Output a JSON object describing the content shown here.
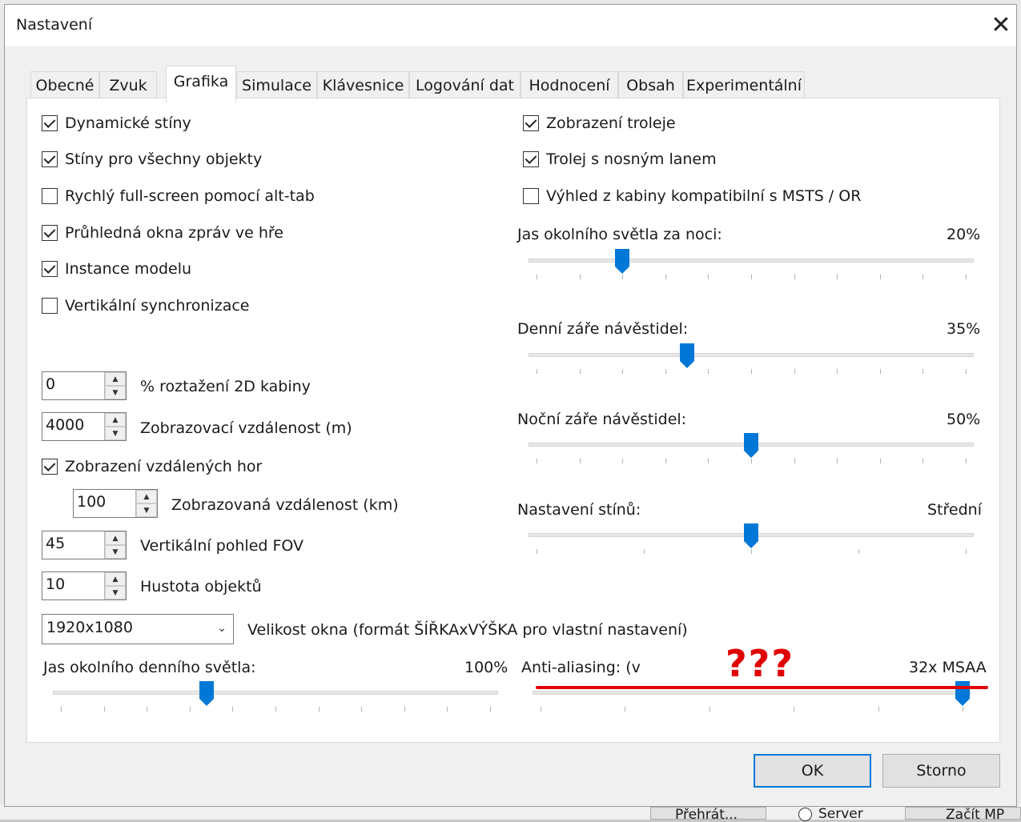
{
  "window": {
    "title": "Nastavení",
    "close_glyph": "✕"
  },
  "tabs": [
    {
      "label": "Obecné",
      "active": false
    },
    {
      "label": "Zvuk",
      "active": false
    },
    {
      "label": "Grafika",
      "active": true
    },
    {
      "label": "Simulace",
      "active": false
    },
    {
      "label": "Klávesnice",
      "active": false
    },
    {
      "label": "Logování dat",
      "active": false
    },
    {
      "label": "Hodnocení",
      "active": false
    },
    {
      "label": "Obsah",
      "active": false
    },
    {
      "label": "Experimentální",
      "active": false
    }
  ],
  "left_checkboxes": [
    {
      "label": "Dynamické stíny",
      "checked": true
    },
    {
      "label": "Stíny pro všechny objekty",
      "checked": true
    },
    {
      "label": "Rychlý full-screen pomocí alt-tab",
      "checked": false
    },
    {
      "label": "Průhledná okna zpráv ve hře",
      "checked": true
    },
    {
      "label": "Instance modelu",
      "checked": true
    },
    {
      "label": "Vertikální synchronizace",
      "checked": false
    }
  ],
  "right_checkboxes": [
    {
      "label": "Zobrazení troleje",
      "checked": true
    },
    {
      "label": "Trolej s nosným lanem",
      "checked": true
    },
    {
      "label": "Výhled z kabiny kompatibilní s MSTS / OR",
      "checked": false
    }
  ],
  "spinners": {
    "cab_stretch": {
      "value": "0",
      "label": "% roztažení 2D kabiny"
    },
    "view_distance": {
      "value": "4000",
      "label": "Zobrazovací vzdálenost (m)"
    },
    "mountain_distance": {
      "value": "100",
      "label": "Zobrazovaná vzdálenost (km)"
    },
    "fov": {
      "value": "45",
      "label": "Vertikální pohled FOV"
    },
    "object_density": {
      "value": "10",
      "label": "Hustota objektů"
    }
  },
  "distant_mountains": {
    "label": "Zobrazení vzdálených hor",
    "checked": true
  },
  "window_size": {
    "value": "1920x1080",
    "label": "Velikost okna (formát ŠÍŘKAxVÝŠKA pro vlastní nastavení)"
  },
  "sliders": {
    "night_ambient": {
      "label": "Jas okolního světla za noci:",
      "value_text": "20%",
      "fraction": 0.2
    },
    "day_signal_glow": {
      "label": "Denní záře návěstidel:",
      "value_text": "35%",
      "fraction": 0.35
    },
    "night_signal_glow": {
      "label": "Noční záře návěstidel:",
      "value_text": "50%",
      "fraction": 0.5
    },
    "shadow_quality": {
      "label": "Nastavení stínů:",
      "value_text": "Střední",
      "fraction": 0.5
    },
    "day_ambient": {
      "label": "Jas okolního denního světla:",
      "value_text": "100%",
      "fraction": 0.34
    },
    "anti_aliasing": {
      "label": "Anti-aliasing: (v",
      "value_text": "32x MSAA",
      "fraction": 1.0
    }
  },
  "annotation": {
    "text": "???",
    "color": "#e10000"
  },
  "buttons": {
    "ok": "OK",
    "cancel": "Storno"
  },
  "background": {
    "button1": "Přehrát...",
    "radio": "Server",
    "button2": "Začít MP"
  },
  "colors": {
    "accent": "#0078d7",
    "annotation_red": "#e10000"
  }
}
